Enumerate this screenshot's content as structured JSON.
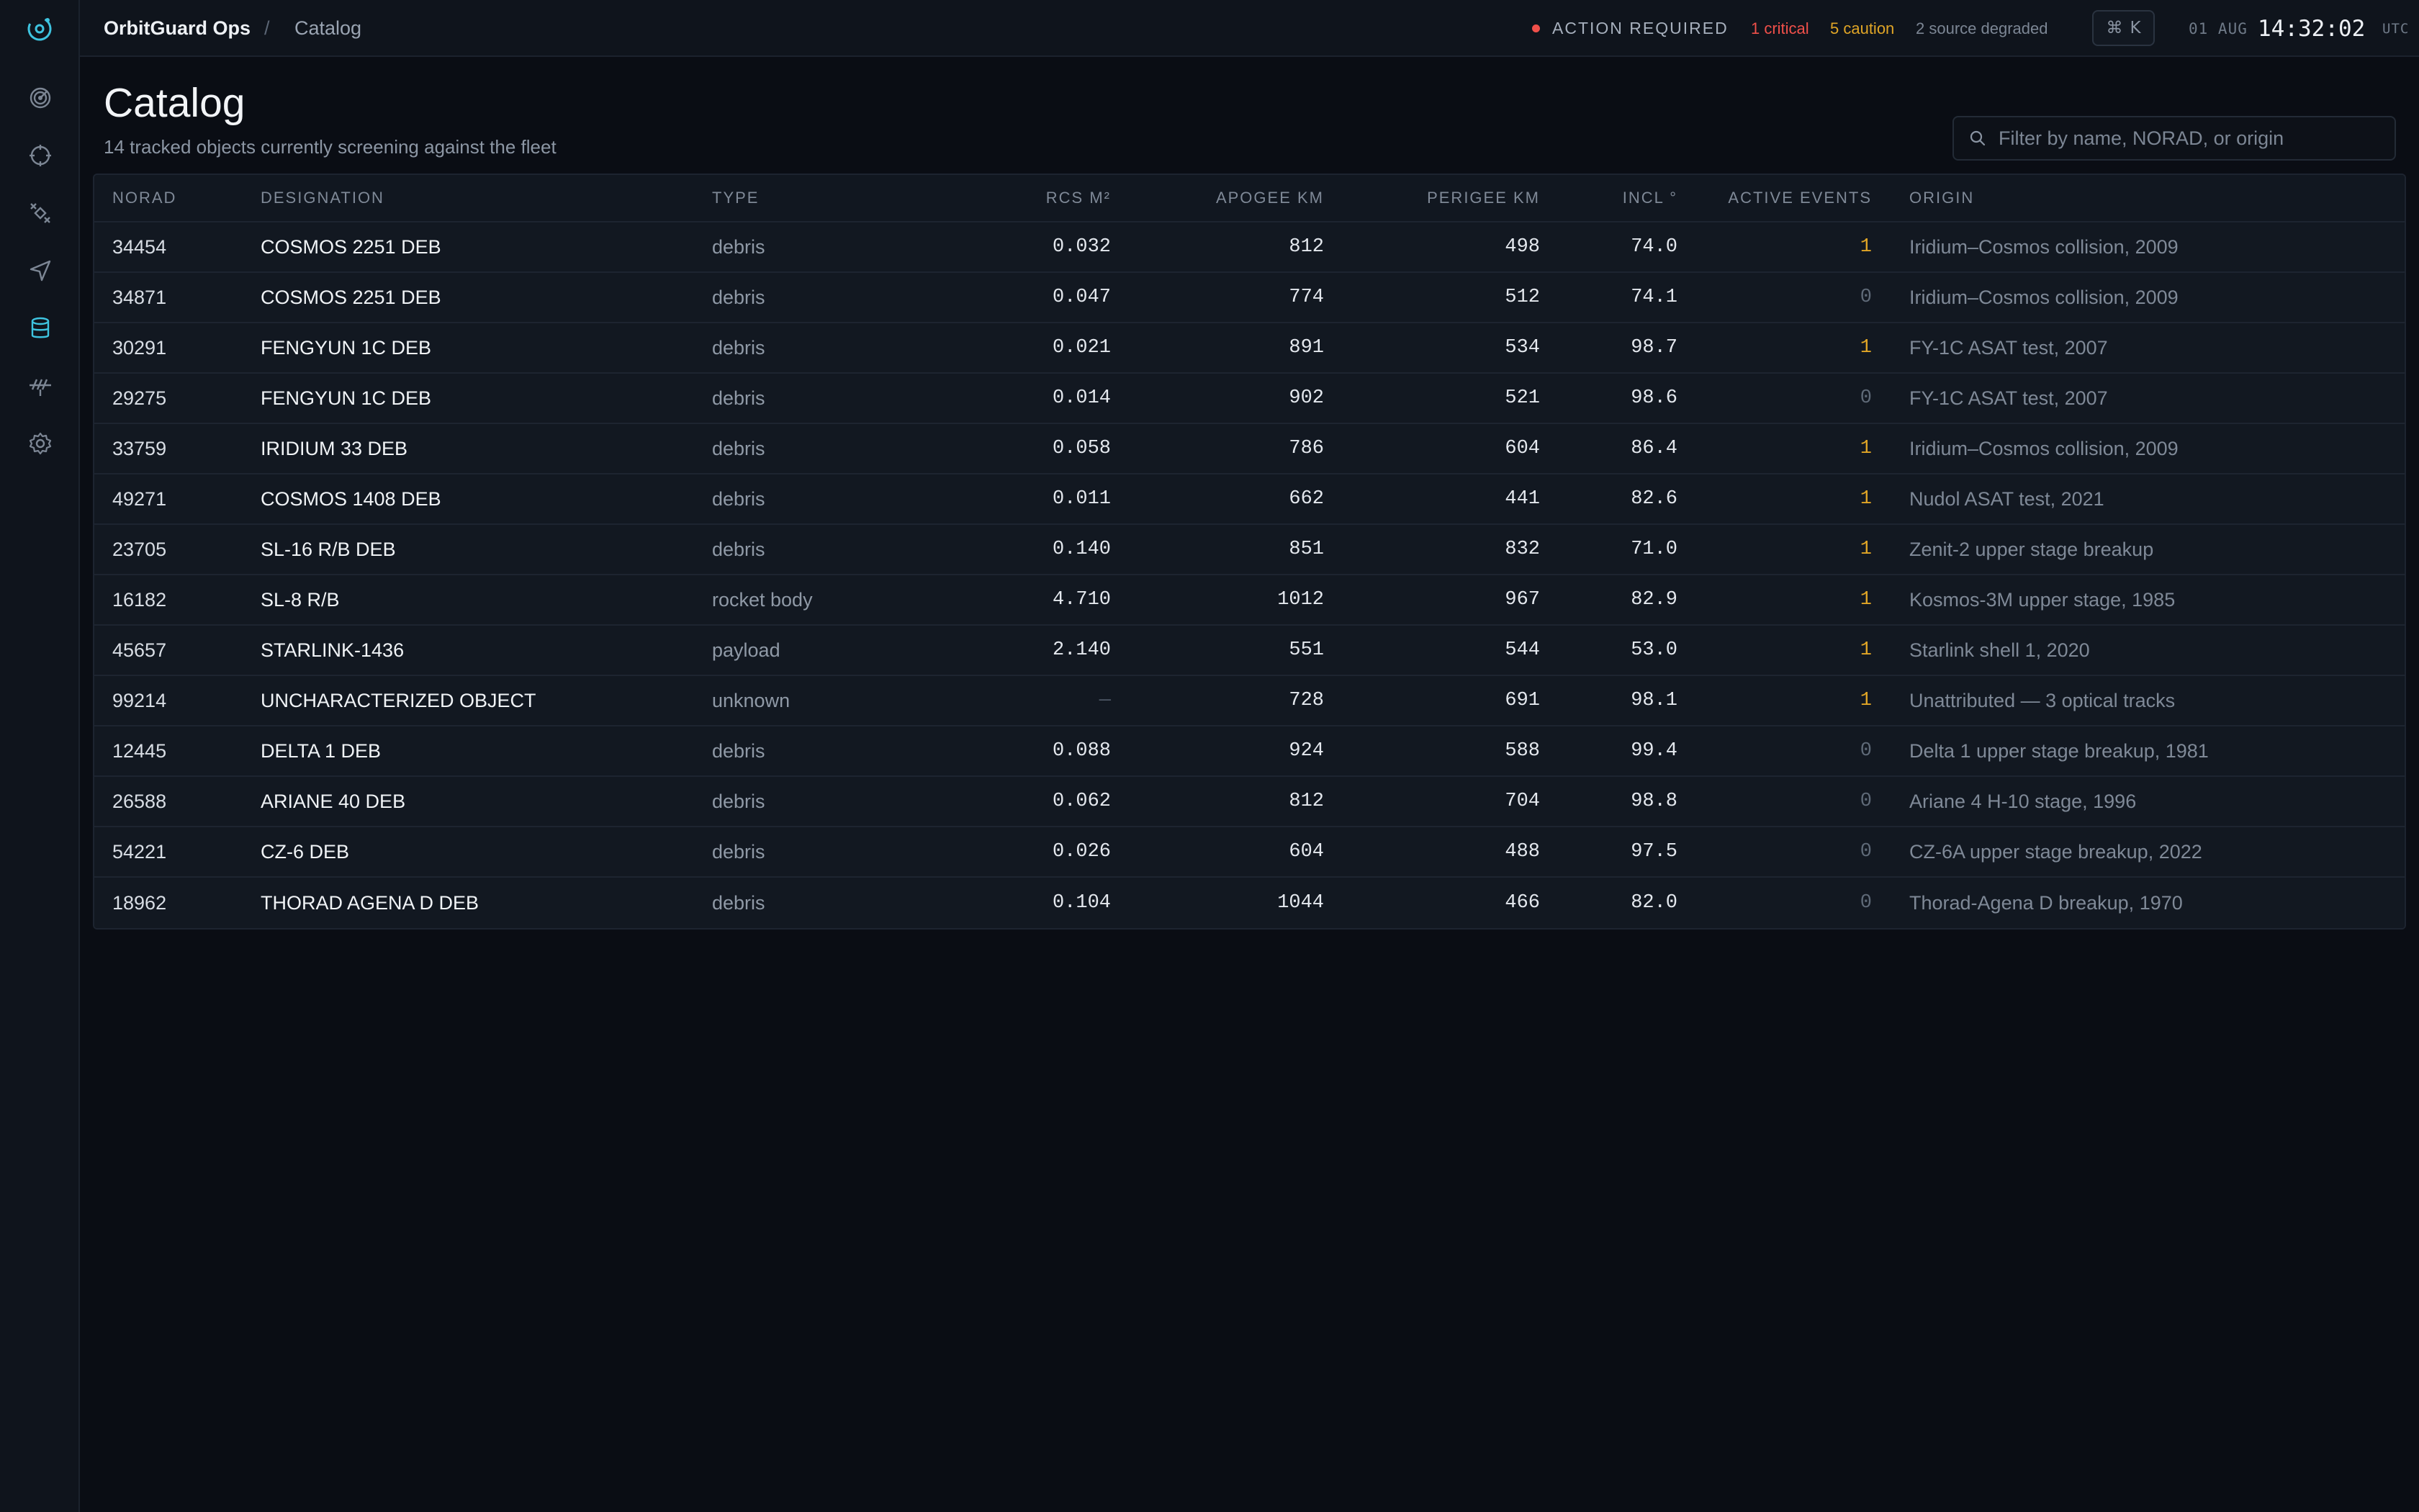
{
  "topbar": {
    "brand": "OrbitGuard Ops",
    "separator": "/",
    "breadcrumb": "Catalog",
    "status_label": "ACTION REQUIRED",
    "critical": "1 critical",
    "caution": "5 caution",
    "degraded": "2 source degraded",
    "shortcut_symbol": "⌘",
    "shortcut_key": "K",
    "date": "01 AUG",
    "time": "14:32:02",
    "tz": "UTC"
  },
  "colors": {
    "accent": "#3ec4e0",
    "critical": "#f0504a",
    "caution": "#e0a526"
  },
  "sidebar": {
    "logo": "orbit-logo-icon",
    "items": [
      {
        "icon": "radar-icon",
        "active": false
      },
      {
        "icon": "crosshair-icon",
        "active": false
      },
      {
        "icon": "satellite-icon",
        "active": false
      },
      {
        "icon": "send-icon",
        "active": false
      },
      {
        "icon": "database-icon",
        "active": true
      },
      {
        "icon": "antenna-icon",
        "active": false
      },
      {
        "icon": "gear-icon",
        "active": false
      }
    ]
  },
  "page": {
    "title": "Catalog",
    "subtitle": "14 tracked objects currently screening against the fleet",
    "search_placeholder": "Filter by name, NORAD, or origin"
  },
  "table": {
    "columns": {
      "norad": "NORAD",
      "designation": "DESIGNATION",
      "type": "TYPE",
      "rcs": "RCS M²",
      "apogee": "APOGEE KM",
      "perigee": "PERIGEE KM",
      "incl": "INCL °",
      "events": "ACTIVE EVENTS",
      "origin": "ORIGIN"
    },
    "rows": [
      {
        "norad": "34454",
        "designation": "COSMOS 2251 DEB",
        "type": "debris",
        "rcs": "0.032",
        "apogee": "812",
        "perigee": "498",
        "incl": "74.0",
        "events": "1",
        "origin": "Iridium–Cosmos collision, 2009"
      },
      {
        "norad": "34871",
        "designation": "COSMOS 2251 DEB",
        "type": "debris",
        "rcs": "0.047",
        "apogee": "774",
        "perigee": "512",
        "incl": "74.1",
        "events": "0",
        "origin": "Iridium–Cosmos collision, 2009"
      },
      {
        "norad": "30291",
        "designation": "FENGYUN 1C DEB",
        "type": "debris",
        "rcs": "0.021",
        "apogee": "891",
        "perigee": "534",
        "incl": "98.7",
        "events": "1",
        "origin": "FY-1C ASAT test, 2007"
      },
      {
        "norad": "29275",
        "designation": "FENGYUN 1C DEB",
        "type": "debris",
        "rcs": "0.014",
        "apogee": "902",
        "perigee": "521",
        "incl": "98.6",
        "events": "0",
        "origin": "FY-1C ASAT test, 2007"
      },
      {
        "norad": "33759",
        "designation": "IRIDIUM 33 DEB",
        "type": "debris",
        "rcs": "0.058",
        "apogee": "786",
        "perigee": "604",
        "incl": "86.4",
        "events": "1",
        "origin": "Iridium–Cosmos collision, 2009"
      },
      {
        "norad": "49271",
        "designation": "COSMOS 1408 DEB",
        "type": "debris",
        "rcs": "0.011",
        "apogee": "662",
        "perigee": "441",
        "incl": "82.6",
        "events": "1",
        "origin": "Nudol ASAT test, 2021"
      },
      {
        "norad": "23705",
        "designation": "SL-16 R/B DEB",
        "type": "debris",
        "rcs": "0.140",
        "apogee": "851",
        "perigee": "832",
        "incl": "71.0",
        "events": "1",
        "origin": "Zenit-2 upper stage breakup"
      },
      {
        "norad": "16182",
        "designation": "SL-8 R/B",
        "type": "rocket body",
        "rcs": "4.710",
        "apogee": "1012",
        "perigee": "967",
        "incl": "82.9",
        "events": "1",
        "origin": "Kosmos-3M upper stage, 1985"
      },
      {
        "norad": "45657",
        "designation": "STARLINK-1436",
        "type": "payload",
        "rcs": "2.140",
        "apogee": "551",
        "perigee": "544",
        "incl": "53.0",
        "events": "1",
        "origin": "Starlink shell 1, 2020"
      },
      {
        "norad": "99214",
        "designation": "UNCHARACTERIZED OBJECT",
        "type": "unknown",
        "rcs": "—",
        "apogee": "728",
        "perigee": "691",
        "incl": "98.1",
        "events": "1",
        "origin": "Unattributed — 3 optical tracks"
      },
      {
        "norad": "12445",
        "designation": "DELTA 1 DEB",
        "type": "debris",
        "rcs": "0.088",
        "apogee": "924",
        "perigee": "588",
        "incl": "99.4",
        "events": "0",
        "origin": "Delta 1 upper stage breakup, 1981"
      },
      {
        "norad": "26588",
        "designation": "ARIANE 40 DEB",
        "type": "debris",
        "rcs": "0.062",
        "apogee": "812",
        "perigee": "704",
        "incl": "98.8",
        "events": "0",
        "origin": "Ariane 4 H-10 stage, 1996"
      },
      {
        "norad": "54221",
        "designation": "CZ-6 DEB",
        "type": "debris",
        "rcs": "0.026",
        "apogee": "604",
        "perigee": "488",
        "incl": "97.5",
        "events": "0",
        "origin": "CZ-6A upper stage breakup, 2022"
      },
      {
        "norad": "18962",
        "designation": "THORAD AGENA D DEB",
        "type": "debris",
        "rcs": "0.104",
        "apogee": "1044",
        "perigee": "466",
        "incl": "82.0",
        "events": "0",
        "origin": "Thorad-Agena D breakup, 1970"
      }
    ]
  }
}
